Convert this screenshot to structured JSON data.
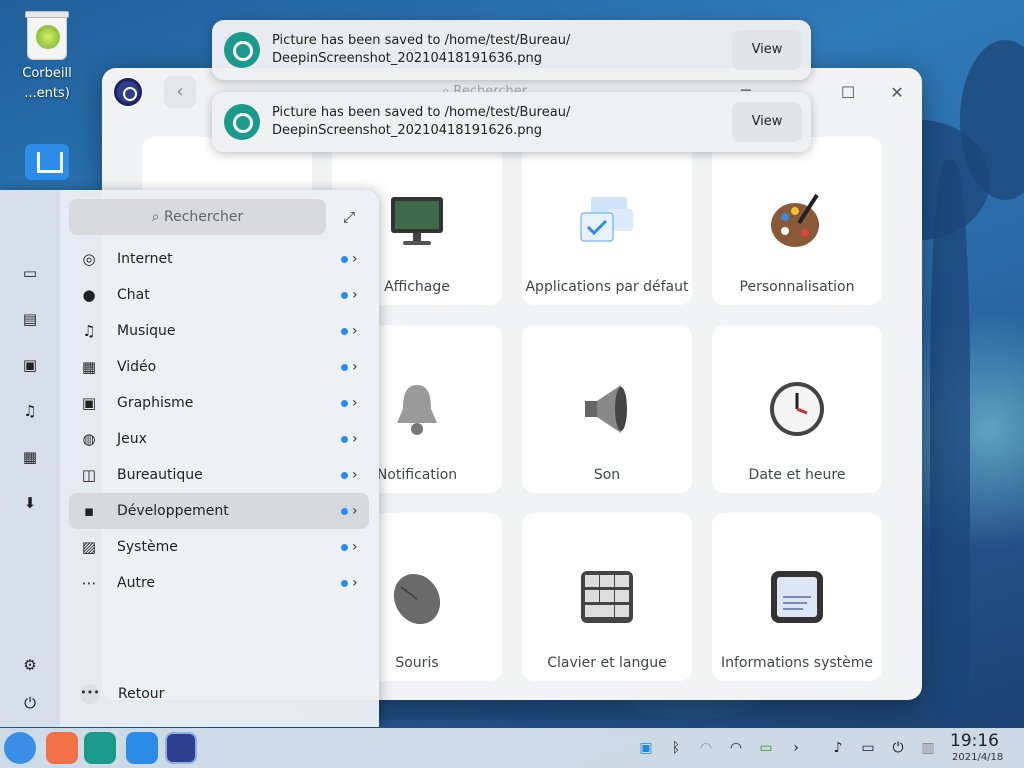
{
  "desktop": {
    "icons": [
      {
        "label": "Corbeill\n...ents)",
        "icon": "trash-icon"
      },
      {
        "label": "",
        "icon": "home-folder-icon"
      }
    ]
  },
  "notifications": [
    {
      "line1": "Picture has been saved to /home/test/Bureau/",
      "line2": "DeepinScreenshot_20210418191636.png",
      "button": "View"
    },
    {
      "line1": "Picture has been saved to /home/test/Bureau/",
      "line2": "DeepinScreenshot_20210418191626.png",
      "button": "View"
    }
  ],
  "control_center": {
    "search_placeholder": "Rechercher",
    "tiles": [
      {
        "label": "Affichage",
        "icon": "display-icon"
      },
      {
        "label": "Applications par défaut",
        "icon": "default-apps-icon"
      },
      {
        "label": "Personnalisation",
        "icon": "palette-icon"
      },
      {
        "label": "Notification",
        "icon": "bell-icon"
      },
      {
        "label": "Son",
        "icon": "speaker-icon"
      },
      {
        "label": "Date et heure",
        "icon": "clock-icon"
      },
      {
        "label": "Souris",
        "icon": "mouse-icon"
      },
      {
        "label": "Clavier et langue",
        "icon": "keyboard-icon"
      },
      {
        "label": "Informations système",
        "icon": "system-info-icon"
      }
    ]
  },
  "launcher": {
    "search_placeholder": "Rechercher",
    "categories": [
      {
        "label": "Internet",
        "icon": "globe-icon"
      },
      {
        "label": "Chat",
        "icon": "chat-icon"
      },
      {
        "label": "Musique",
        "icon": "music-icon"
      },
      {
        "label": "Vidéo",
        "icon": "video-icon"
      },
      {
        "label": "Graphisme",
        "icon": "image-icon"
      },
      {
        "label": "Jeux",
        "icon": "gamepad-icon"
      },
      {
        "label": "Bureautique",
        "icon": "presentation-icon"
      },
      {
        "label": "Développement",
        "icon": "terminal-icon"
      },
      {
        "label": "Système",
        "icon": "system-icon"
      },
      {
        "label": "Autre",
        "icon": "more-icon"
      }
    ],
    "active_category": "Développement",
    "back_label": "Retour",
    "accent": "#2a8cf0"
  },
  "taskbar": {
    "time": "19:16",
    "date": "2021/4/18"
  }
}
